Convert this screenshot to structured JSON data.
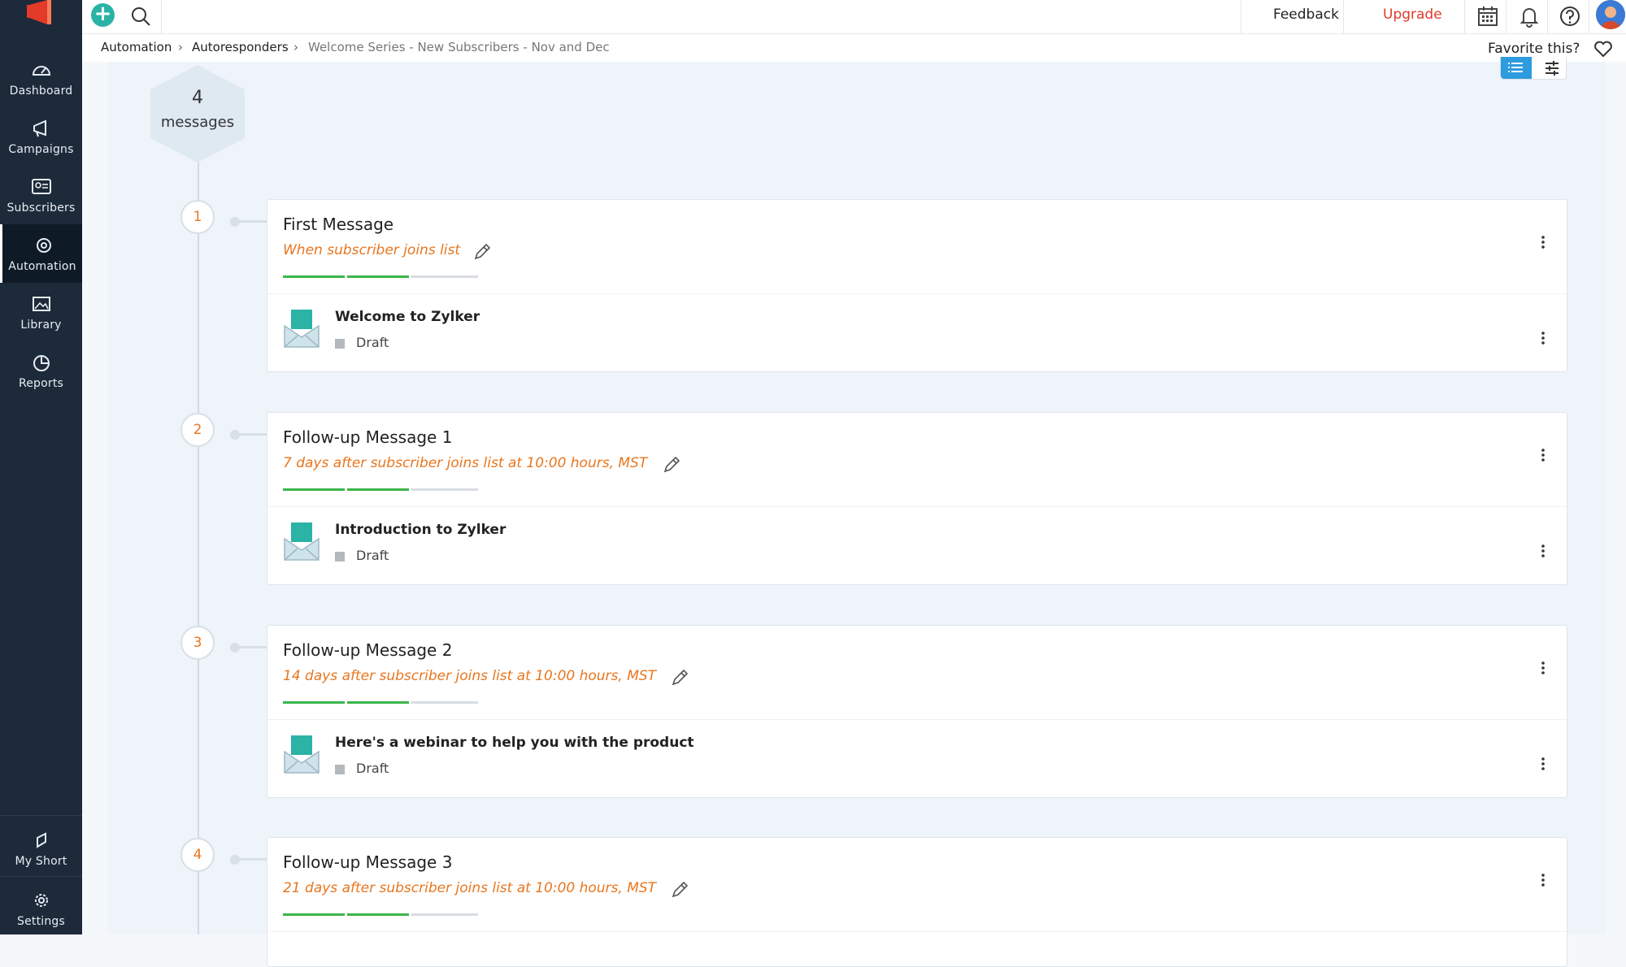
{
  "sidebar": {
    "items": [
      {
        "label": "Dashboard",
        "icon": "dashboard-icon"
      },
      {
        "label": "Campaigns",
        "icon": "megaphone-icon"
      },
      {
        "label": "Subscribers",
        "icon": "subscribers-icon"
      },
      {
        "label": "Automation",
        "icon": "automation-icon",
        "active": true
      },
      {
        "label": "Library",
        "icon": "image-icon"
      },
      {
        "label": "Reports",
        "icon": "pie-chart-icon"
      }
    ],
    "bottom": [
      {
        "label": "My Short",
        "icon": "shortcut-icon"
      },
      {
        "label": "Settings",
        "icon": "gear-icon"
      }
    ]
  },
  "topbar": {
    "feedback": "Feedback",
    "upgrade": "Upgrade"
  },
  "breadcrumb": {
    "items": [
      "Automation",
      "Autoresponders",
      "Welcome Series - New Subscribers - Nov and Dec"
    ],
    "separator": "›"
  },
  "favorite": "Favorite this?",
  "summary": {
    "count": "4",
    "label": "messages"
  },
  "messages": [
    {
      "step": "1",
      "title": "First Message",
      "trigger": "When subscriber joins list",
      "email_title": "Welcome to Zylker",
      "status": "Draft",
      "progress_segments_done": 2
    },
    {
      "step": "2",
      "title": "Follow-up Message 1",
      "trigger": "7  days after subscriber joins list at  10:00 hours, MST",
      "email_title": "Introduction to Zylker",
      "status": "Draft",
      "progress_segments_done": 2
    },
    {
      "step": "3",
      "title": "Follow-up Message 2",
      "trigger": "14  days after subscriber joins list at  10:00 hours, MST",
      "email_title": "Here's a webinar to help you with the product",
      "status": "Draft",
      "progress_segments_done": 2
    },
    {
      "step": "4",
      "title": "Follow-up Message 3",
      "trigger": "21  days after subscriber joins list at  10:00 hours, MST",
      "progress_segments_done": 2
    }
  ],
  "colors": {
    "accent_orange": "#e8761f",
    "progress_green": "#3bb54a",
    "brand_red": "#e23b2a",
    "sidebar_bg": "#1d2a3a",
    "toggle_blue": "#2d9bde"
  }
}
